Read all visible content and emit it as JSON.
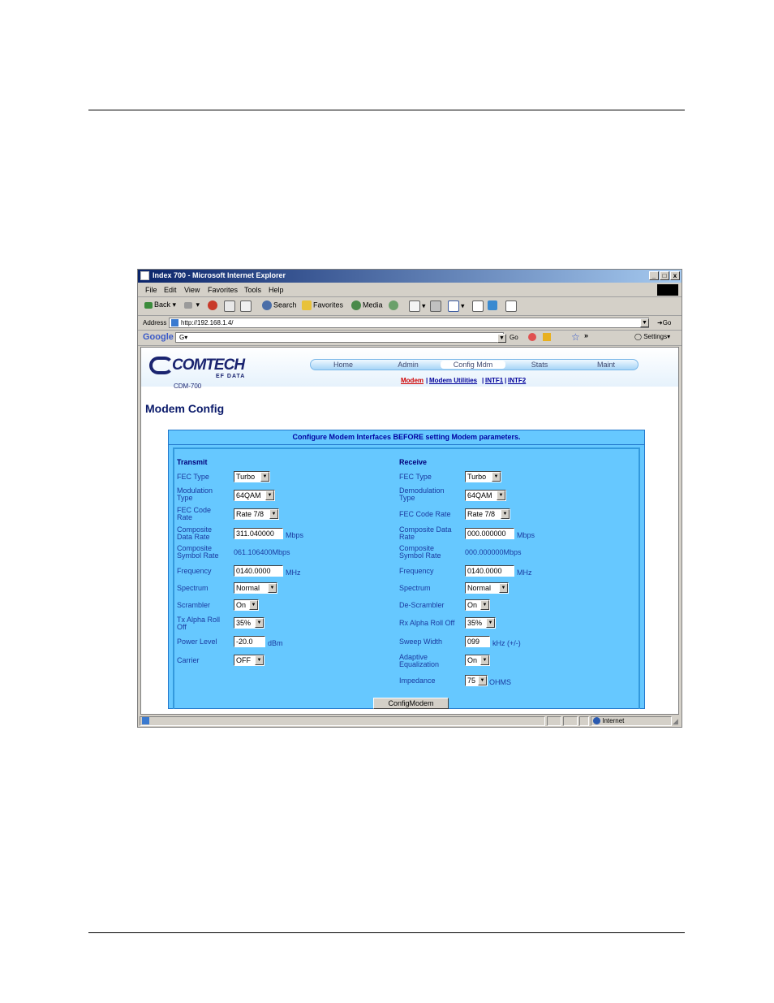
{
  "window": {
    "title": "Index 700 - Microsoft Internet Explorer",
    "minimize": "_",
    "maximize": "□",
    "close": "x"
  },
  "menu": [
    "File",
    "Edit",
    "View",
    "Favorites",
    "Tools",
    "Help"
  ],
  "toolbar": {
    "back": "Back",
    "search": "Search",
    "favorites": "Favorites",
    "media": "Media"
  },
  "address": {
    "label": "Address",
    "url": "http://192.168.1.4/",
    "go": "Go"
  },
  "google_bar": {
    "logo": "Google",
    "go": "Go",
    "more": "»",
    "settings": "Settings"
  },
  "site": {
    "logo": "COMTECH",
    "logo_sub": "EF DATA",
    "model": "CDM-700",
    "nav": [
      "Home",
      "Admin",
      "Config Mdm",
      "Stats",
      "Maint"
    ],
    "subnav": [
      "Modem",
      "Modem Utilities",
      "INTF1",
      "INTF2"
    ],
    "page_title": "Modem Config",
    "banner": "Configure Modem Interfaces BEFORE setting Modem parameters."
  },
  "transmit": {
    "heading": "Transmit",
    "fec_type": {
      "label": "FEC Type",
      "value": "Turbo"
    },
    "modulation": {
      "label1": "Modulation",
      "label2": "Type",
      "value": "64QAM"
    },
    "fec_code": {
      "label1": "FEC Code",
      "label2": "Rate",
      "value": "Rate 7/8"
    },
    "data_rate": {
      "label1": "Composite",
      "label2": "Data Rate",
      "value": "311.040000",
      "unit": "Mbps"
    },
    "symbol_rate": {
      "label1": "Composite",
      "label2": "Symbol Rate",
      "value": "061.106400Mbps"
    },
    "frequency": {
      "label": "Frequency",
      "value": "0140.0000",
      "unit": "MHz"
    },
    "spectrum": {
      "label": "Spectrum",
      "value": "Normal"
    },
    "scrambler": {
      "label": "Scrambler",
      "value": "On"
    },
    "alpha": {
      "label1": "Tx Alpha Roll",
      "label2": "Off",
      "value": "35%"
    },
    "power": {
      "label": "Power Level",
      "value": "-20.0",
      "unit": "dBm"
    },
    "carrier": {
      "label": "Carrier",
      "value": "OFF"
    }
  },
  "receive": {
    "heading": "Receive",
    "fec_type": {
      "label": "FEC Type",
      "value": "Turbo"
    },
    "demodulation": {
      "label1": "Demodulation",
      "label2": "Type",
      "value": "64QAM"
    },
    "fec_code": {
      "label": "FEC Code Rate",
      "value": "Rate 7/8"
    },
    "data_rate": {
      "label1": "Composite Data",
      "label2": "Rate",
      "value": "000.000000",
      "unit": "Mbps"
    },
    "symbol_rate": {
      "label1": "Composite",
      "label2": "Symbol Rate",
      "value": "000.000000Mbps"
    },
    "frequency": {
      "label": "Frequency",
      "value": "0140.0000",
      "unit": "MHz"
    },
    "spectrum": {
      "label": "Spectrum",
      "value": "Normal"
    },
    "descrambler": {
      "label": "De-Scrambler",
      "value": "On"
    },
    "alpha": {
      "label": "Rx Alpha Roll Off",
      "value": "35%"
    },
    "sweep": {
      "label": "Sweep Width",
      "value": "099",
      "unit": "kHz (+/-)"
    },
    "equalization": {
      "label1": "Adaptive",
      "label2": "Equalization",
      "value": "On"
    },
    "impedance": {
      "label": "Impedance",
      "value": "75",
      "unit": "OHMS"
    }
  },
  "submit": "ConfigModem",
  "statusbar": {
    "zone": "Internet"
  }
}
